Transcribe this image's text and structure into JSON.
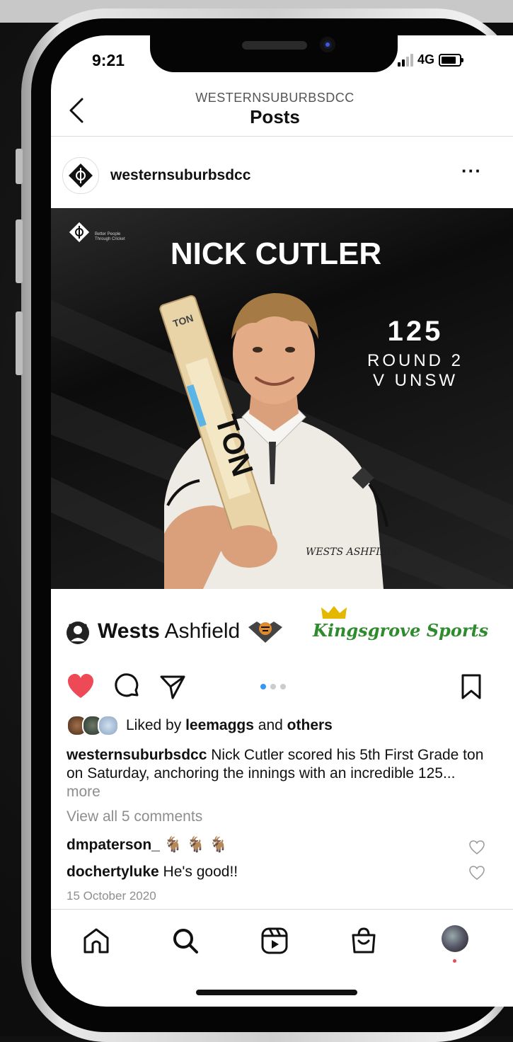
{
  "status_bar": {
    "time": "9:21",
    "network": "4G"
  },
  "header": {
    "account": "WESTERNSUBURBSDCC",
    "title": "Posts"
  },
  "post": {
    "username": "westernsuburbsdcc",
    "image": {
      "logo_tagline": "Better People Through Cricket",
      "player_name": "NICK CUTLER",
      "score": "125",
      "round": "ROUND 2",
      "opponent": "V UNSW",
      "bat_brand": "TON",
      "shirt_sponsor": "WESTS ASHFIELD Leagues"
    },
    "sponsors": {
      "wests_bold": "Wests",
      "wests_regular": " Ashfield",
      "kingsgrove": "Kingsgrove Sports"
    },
    "carousel": {
      "count": 3,
      "active": 0
    },
    "liked": true,
    "likes": {
      "prefix": "Liked by ",
      "user": "leemaggs",
      "conj": " and ",
      "others": "others"
    },
    "caption": {
      "user": "westernsuburbsdcc",
      "text": " Nick Cutler scored his 5th First Grade ton on Saturday, anchoring the innings with an incredible 125...",
      "more": " more"
    },
    "view_all_comments": "View all 5 comments",
    "comments": [
      {
        "user": "dmpaterson_",
        "text": " 🐐 🐐 🐐"
      },
      {
        "user": "dochertyluke",
        "text": " He's good!!"
      }
    ],
    "date": "15 October 2020"
  },
  "colors": {
    "like_red": "#ed4956",
    "link_blue": "#3897f0",
    "green": "#2e8b2e"
  },
  "icons": {
    "header": [
      "back-chevron-icon"
    ],
    "actions": [
      "heart-icon",
      "comment-icon",
      "share-icon",
      "bookmark-icon"
    ],
    "tabs": [
      "home-icon",
      "search-icon",
      "reels-icon",
      "shop-icon",
      "profile-avatar"
    ]
  }
}
